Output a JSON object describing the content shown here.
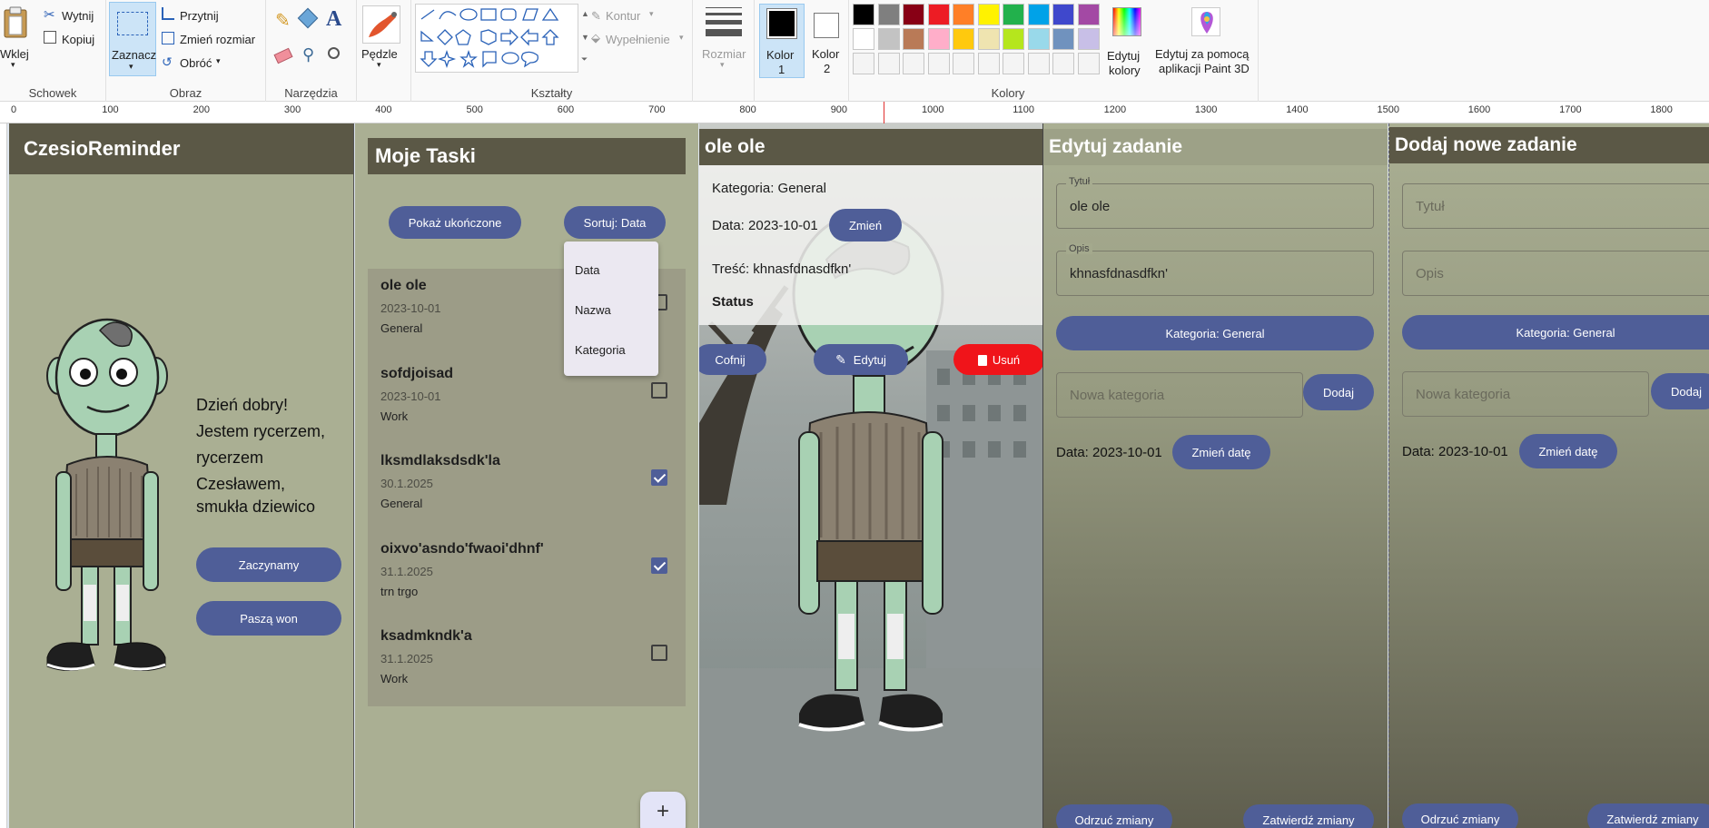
{
  "ribbon": {
    "clipboard": {
      "paste": "Wklej",
      "cut": "Wytnij",
      "copy": "Kopiuj",
      "group": "Schowek"
    },
    "image": {
      "select": "Zaznacz",
      "crop": "Przytnij",
      "resize": "Zmień rozmiar",
      "rotate": "Obróć",
      "group": "Obraz"
    },
    "tools": {
      "group": "Narzędzia"
    },
    "brushes": {
      "label": "Pędzle"
    },
    "shapes": {
      "outline": "Kontur",
      "fill": "Wypełnienie",
      "group": "Kształty"
    },
    "size": {
      "label": "Rozmiar"
    },
    "color1": {
      "label": "Kolor",
      "num": "1"
    },
    "color2": {
      "label": "Kolor",
      "num": "2"
    },
    "colors": {
      "group": "Kolory",
      "edit_line1": "Edytuj",
      "edit_line2": "kolory"
    },
    "paint3d": {
      "line1": "Edytuj za pomocą",
      "line2": "aplikacji Paint 3D"
    },
    "palette_row1": [
      "#000000",
      "#7f7f7f",
      "#880015",
      "#ed1c24",
      "#ff7f27",
      "#fff200",
      "#22b14c",
      "#00a2e8",
      "#3f48cc",
      "#a349a4"
    ],
    "palette_row2": [
      "#ffffff",
      "#c3c3c3",
      "#b97a57",
      "#ffaec9",
      "#ffc90e",
      "#efe4b0",
      "#b5e61d",
      "#99d9ea",
      "#7092be",
      "#c8bfe7"
    ]
  },
  "ruler_ticks": [
    "0",
    "100",
    "200",
    "300",
    "400",
    "500",
    "600",
    "700",
    "800",
    "900",
    "1000",
    "1100",
    "1200",
    "1300",
    "1400",
    "1500",
    "1600",
    "1700",
    "1800"
  ],
  "screen1": {
    "title": "CzesioReminder",
    "greeting": [
      "Dzień dobry!",
      "Jestem rycerzem,",
      "rycerzem",
      "Czesławem,",
      "smukła dziewico"
    ],
    "start_button": "Zaczynamy",
    "leave_button": "Paszą won"
  },
  "screen2": {
    "title": "Moje Taski",
    "show_completed": "Pokaż ukończone",
    "sort_button": "Sortuj: Data",
    "sort_options": [
      "Data",
      "Nazwa",
      "Kategoria"
    ],
    "tasks": [
      {
        "title": "ole ole",
        "date": "2023-10-01",
        "category": "General",
        "done": false
      },
      {
        "title": "sofdjoisad",
        "date": "2023-10-01",
        "category": "Work",
        "done": false
      },
      {
        "title": "lksmdlaksdsdk'la",
        "date": "30.1.2025",
        "category": "General",
        "done": true
      },
      {
        "title": "oixvo'asndo'fwaoi'dhnf'",
        "date": "31.1.2025",
        "category": "trn trgo",
        "done": true
      },
      {
        "title": "ksadmkndk'a",
        "date": "31.1.2025",
        "category": "Work",
        "done": false
      }
    ],
    "fab": "+"
  },
  "screen3": {
    "title": "ole ole",
    "category": "Kategoria: General",
    "date": "Data: 2023-10-01",
    "change_button": "Zmień",
    "content": "Treść: khnasfdnasdfkn'",
    "status": "Status",
    "back_button": "Cofnij",
    "edit_button": "Edytuj",
    "delete_button": "Usuń"
  },
  "screen4": {
    "title": "Edytuj zadanie",
    "title_label": "Tytuł",
    "title_value": "ole ole",
    "desc_label": "Opis",
    "desc_value": "khnasfdnasdfkn'",
    "category_button": "Kategoria: General",
    "new_category_placeholder": "Nowa kategoria",
    "add_button": "Dodaj",
    "date": "Data: 2023-10-01",
    "change_date": "Zmień datę",
    "discard": "Odrzuć zmiany",
    "confirm": "Zatwierdź zmiany"
  },
  "screen5": {
    "title": "Dodaj nowe zadanie",
    "title_placeholder": "Tytuł",
    "desc_placeholder": "Opis",
    "category_button": "Kategoria: General",
    "new_category_placeholder": "Nowa kategoria",
    "add_button": "Dodaj",
    "date": "Data: 2023-10-01",
    "change_date": "Zmień datę",
    "discard": "Odrzuć zmiany",
    "confirm": "Zatwierdź zmiany"
  }
}
